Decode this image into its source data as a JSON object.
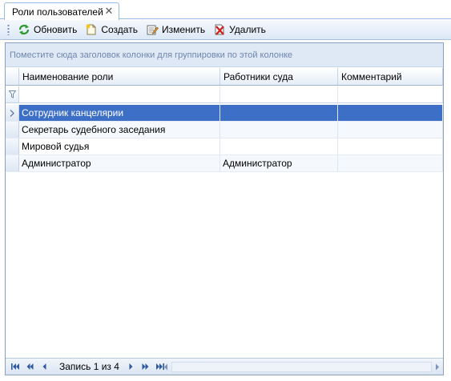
{
  "tab": {
    "title": "Роли пользователей",
    "close_glyph": "✕"
  },
  "toolbar": {
    "refresh_label": "Обновить",
    "create_label": "Создать",
    "edit_label": "Изменить",
    "delete_label": "Удалить"
  },
  "grid": {
    "group_panel_hint": "Поместите сюда заголовок колонки для группировки по этой колонке",
    "columns": [
      "Наименование роли",
      "Работники суда",
      "Комментарий"
    ],
    "rows": [
      {
        "name": "Сотрудник канцелярии",
        "workers": "",
        "comment": "",
        "selected": true
      },
      {
        "name": "Секретарь судебного заседания",
        "workers": "",
        "comment": "",
        "selected": false
      },
      {
        "name": "Мировой судья",
        "workers": "",
        "comment": "",
        "selected": false
      },
      {
        "name": "Администратор",
        "workers": "Администратор",
        "comment": "",
        "selected": false
      }
    ]
  },
  "navigator": {
    "record_text": "Запись 1 из 4"
  },
  "colors": {
    "selected_row": "#3d6fc7",
    "group_panel_bg": "#dfe9f5",
    "border": "#8ba0bc"
  }
}
